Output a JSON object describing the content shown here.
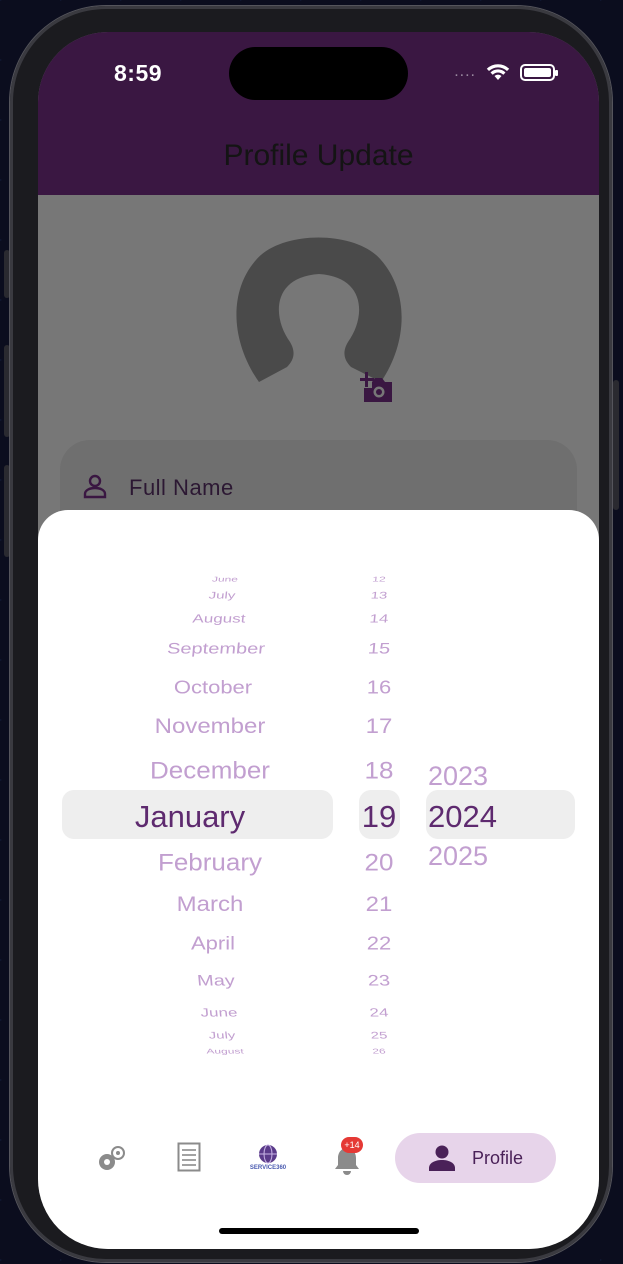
{
  "status_bar": {
    "time": "8:59",
    "signal": "....",
    "icons": [
      "wifi-icon",
      "battery-icon"
    ]
  },
  "app_bar": {
    "title": "Profile Update"
  },
  "profile": {
    "avatar_icon": "person-avatar-placeholder",
    "add_photo_icon": "add-a-photo-icon",
    "full_name_label": "Full Name",
    "full_name_icon": "person-outline-icon"
  },
  "date_picker": {
    "months": [
      "June",
      "July",
      "August",
      "September",
      "October",
      "November",
      "December",
      "January",
      "February",
      "March",
      "April",
      "May",
      "June",
      "July",
      "August"
    ],
    "days": [
      "12",
      "13",
      "14",
      "15",
      "16",
      "17",
      "18",
      "19",
      "20",
      "21",
      "22",
      "23",
      "24",
      "25",
      "26"
    ],
    "years": [
      "2023",
      "2024",
      "2025"
    ],
    "selected": {
      "month": "January",
      "day": "19",
      "year": "2024"
    }
  },
  "bottom_nav": {
    "items": [
      {
        "icon": "settings-gear-icon"
      },
      {
        "icon": "list-document-icon"
      },
      {
        "icon": "service360-logo-icon",
        "logo_text": "SERVICE360"
      },
      {
        "icon": "notification-bell-icon",
        "badge": "+14"
      },
      {
        "icon": "person-icon",
        "label": "Profile"
      }
    ]
  },
  "colors": {
    "primary": "#3a1742",
    "accent": "#5e2a6f",
    "muted_picker": "#c29fd0",
    "nav_active_bg": "#e7d4ea",
    "badge": "#e53935"
  }
}
